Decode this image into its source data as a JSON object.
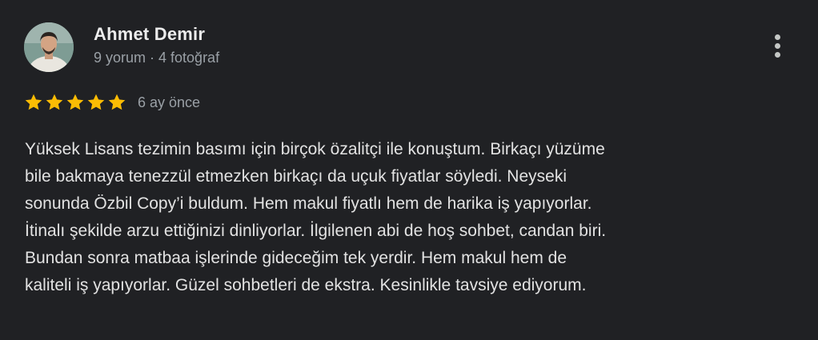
{
  "reviewer": {
    "name": "Ahmet Demir",
    "meta": "9 yorum · 4 fotoğraf"
  },
  "rating": {
    "stars": 5,
    "max": 5,
    "star_color": "#fbbc04",
    "time_ago": "6 ay önce"
  },
  "menu": {
    "icon": "more-vertical-icon"
  },
  "review": {
    "lines": [
      "Yüksek Lisans tezimin basımı için birçok özalitçi ile konuştum. Birkaçı yüzüme",
      "bile bakmaya tenezzül etmezken birkaçı da uçuk fiyatlar söyledi. Neyseki",
      "sonunda Özbil Copy’i buldum. Hem makul fiyatlı hem de harika iş yapıyorlar.",
      "İtinalı şekilde arzu ettiğinizi dinliyorlar. İlgilenen abi de hoş sohbet, candan biri.",
      "Bundan sonra matbaa işlerinde gideceğim tek yerdir. Hem makul hem de",
      "kaliteli iş yapıyorlar. Güzel sohbetleri de ekstra. Kesinlikle tavsiye ediyorum."
    ]
  }
}
